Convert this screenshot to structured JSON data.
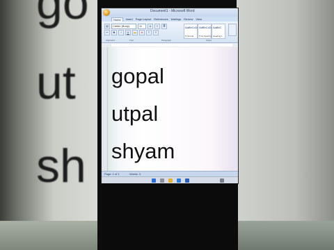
{
  "window": {
    "title": "Document1 - Microsoft Word"
  },
  "ribbon": {
    "tabs": [
      "Home",
      "Insert",
      "Page Layout",
      "References",
      "Mailings",
      "Review",
      "View"
    ],
    "font_name": "Calibri (Body)",
    "font_size": "11",
    "styles": [
      {
        "preview": "AaBbCcDc",
        "name": "¶ Normal"
      },
      {
        "preview": "AaBbCcDc",
        "name": "¶ No Spacing"
      },
      {
        "preview": "AaBbC",
        "name": "Heading 1"
      }
    ],
    "change_styles_label": "Change Styles",
    "groups": [
      "Clipboard",
      "Font",
      "Paragraph",
      "Styles"
    ]
  },
  "document": {
    "lines": [
      "gopal",
      "utpal",
      "shyam"
    ]
  },
  "background": {
    "words": [
      "go",
      "ut",
      "sh"
    ]
  },
  "status": {
    "page": "Page: 1 of 1",
    "words": "Words: 3"
  },
  "colors": {
    "ribbon": "#d5e3f4",
    "text": "#111111",
    "office_button": "#e09a1e"
  }
}
